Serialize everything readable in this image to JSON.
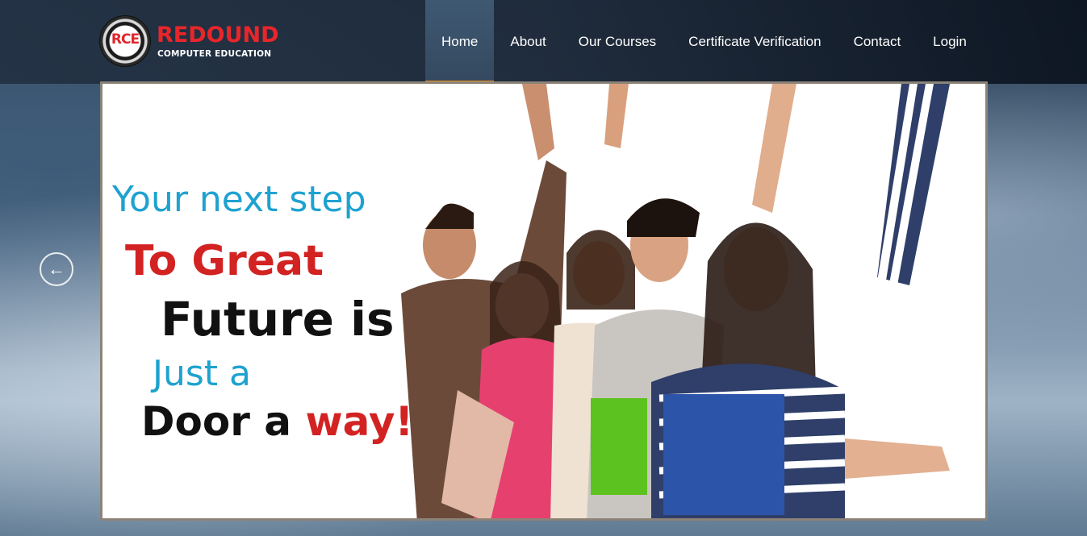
{
  "brand": {
    "badge_letters": "RCE",
    "name": "REDOUND",
    "tagline": "COMPUTER EDUCATION"
  },
  "nav": {
    "items": [
      {
        "label": "Home",
        "active": true
      },
      {
        "label": "About"
      },
      {
        "label": "Our Courses"
      },
      {
        "label": "Certificate Verification"
      },
      {
        "label": "Contact"
      },
      {
        "label": "Login"
      }
    ]
  },
  "slider": {
    "prev_icon": "arrow-left-icon",
    "slide": {
      "line1": "Your next step",
      "line2": "To Great",
      "line3": "Future is",
      "line4": "Just a",
      "line5_a": "Door a",
      "line5_b": "way!"
    }
  },
  "colors": {
    "accent": "#f08c1a",
    "brand_red": "#e8262a",
    "text_blue": "#1ea2d0"
  }
}
